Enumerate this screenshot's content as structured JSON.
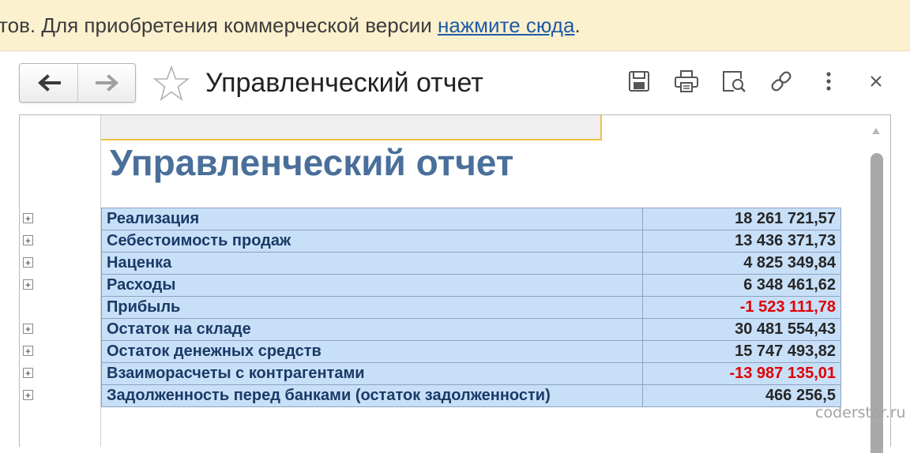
{
  "banner": {
    "text": "тов. Для приобретения коммерческой версии ",
    "link": "нажмите сюда",
    "suffix": "."
  },
  "toolbar": {
    "back": "back-arrow-icon",
    "forward": "forward-arrow-icon",
    "favorite": "star-icon",
    "title": "Управленческий отчет",
    "actions": [
      "save-icon",
      "print-icon",
      "preview-icon",
      "link-icon",
      "more-icon",
      "close-icon"
    ]
  },
  "report": {
    "title": "Управленческий отчет",
    "rows": [
      {
        "label": "Реализация",
        "value": "18 261 721,57",
        "negative": false,
        "expandable": true
      },
      {
        "label": "Себестоимость продаж",
        "value": "13 436 371,73",
        "negative": false,
        "expandable": true
      },
      {
        "label": "Наценка",
        "value": "4 825 349,84",
        "negative": false,
        "expandable": true
      },
      {
        "label": "Расходы",
        "value": "6 348 461,62",
        "negative": false,
        "expandable": true
      },
      {
        "label": "Прибыль",
        "value": "-1 523 111,78",
        "negative": true,
        "expandable": false
      },
      {
        "label": "Остаток на складе",
        "value": "30 481 554,43",
        "negative": false,
        "expandable": true
      },
      {
        "label": "Остаток денежных средств",
        "value": "15 747 493,82",
        "negative": false,
        "expandable": true
      },
      {
        "label": "Взаиморасчеты с контрагентами",
        "value": "-13 987 135,01",
        "negative": true,
        "expandable": true
      },
      {
        "label": "Задолженность перед банками (остаток задолженности)",
        "value": "466 256,5",
        "negative": false,
        "expandable": true
      }
    ]
  },
  "watermark": "coderstar.ru",
  "colors": {
    "banner_bg": "#fbf1cf",
    "row_bg": "#c8dff8",
    "title": "#4a6f9a",
    "negative": "#e00000"
  }
}
